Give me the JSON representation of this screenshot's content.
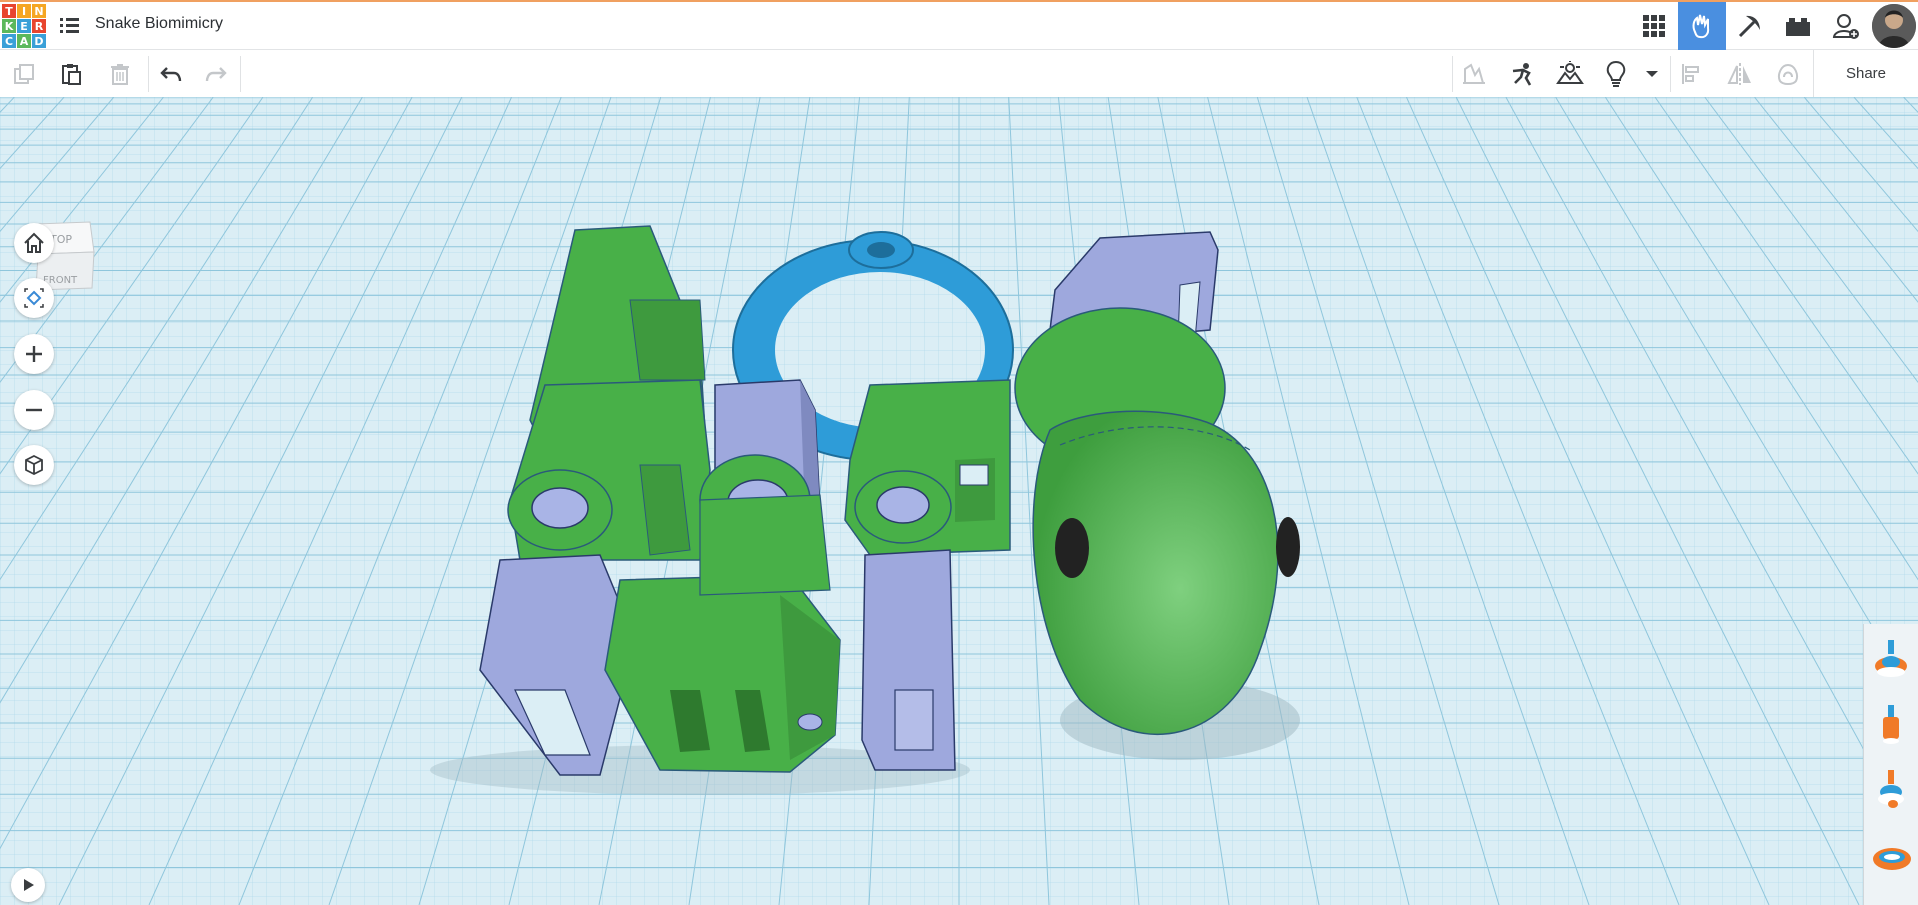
{
  "app": {
    "logo_letters": [
      "T",
      "I",
      "N",
      "K",
      "E",
      "R",
      "C",
      "A",
      "D"
    ],
    "logo_colors": [
      "#e8452e",
      "#f5a623",
      "#f5a623",
      "#5cb85c",
      "#3aa0d8",
      "#e8452e",
      "#3aa0d8",
      "#5cb85c",
      "#3aa0d8"
    ],
    "design_title": "Snake Biomimicry"
  },
  "header": {
    "icons": [
      "grid-view-icon",
      "tinker-hand-icon",
      "pickaxe-icon",
      "bricks-icon",
      "add-user-icon",
      "user-avatar"
    ],
    "active_icon": "tinker-hand-icon",
    "accent_color": "#4a8fe0"
  },
  "toolbar": {
    "left_icons": [
      "copy-icon",
      "paste-icon",
      "delete-icon",
      "undo-icon",
      "redo-icon"
    ],
    "right_icons": [
      "notes-icon",
      "shapes-person-icon",
      "landscape-view-icon",
      "lightbulb-icon",
      "dropdown-icon",
      "align-icon",
      "mirror-icon",
      "group-icon"
    ],
    "share_label": "Share"
  },
  "viewcube": {
    "top_label": "TOP",
    "front_label": "FRONT"
  },
  "nav_controls": [
    "home-view-icon",
    "fit-view-icon",
    "zoom-in-icon",
    "zoom-out-icon",
    "perspective-cube-icon"
  ],
  "side_panel": [
    "shape-stack-orange-blue",
    "shape-stack-orange",
    "shape-stack-blue",
    "shape-ring"
  ],
  "colors": {
    "workplane": "#dbeef5",
    "grid_line": "#9ccde0",
    "snake_green": "#48b048",
    "snake_part_gray": "#9ea8dd",
    "ring_blue": "#2e9cd8"
  }
}
